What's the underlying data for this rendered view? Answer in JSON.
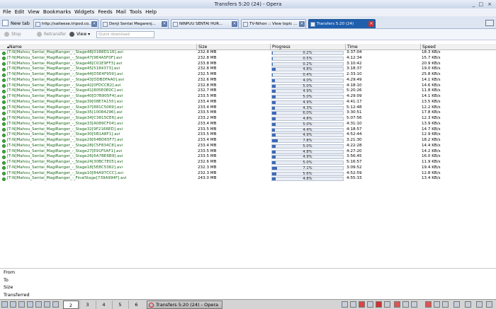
{
  "window": {
    "title": "Transfers 5:20 (24) - Opera",
    "controls": [
      "_",
      "□",
      "×"
    ]
  },
  "menu": [
    "File",
    "Edit",
    "View",
    "Bookmarks",
    "Widgets",
    "Feeds",
    "Mail",
    "Tools",
    "Help"
  ],
  "tabs": {
    "new_tab_label": "New tab",
    "items": [
      {
        "label": "http://saiteexe.tripod.co..."
      },
      {
        "label": "Denji Sentai Megarenj..."
      },
      {
        "label": "NINPUU SENTAI HUR..."
      },
      {
        "label": "TV-Nihon :: View topic ..."
      },
      {
        "label": "Transfers 5:20 (24)",
        "active": true
      }
    ]
  },
  "toolbar": {
    "stop": "Stop",
    "retransfer": "Retransfer",
    "view": "View",
    "quick_placeholder": "Quick download"
  },
  "columns": {
    "name": "Name",
    "size": "Size",
    "progress": "Progress",
    "time": "Time",
    "speed": "Speed"
  },
  "transfers": [
    {
      "name": "[T-N]Mahou_Sentai_MagiRanger_-_Stage48[01B8D116].avi",
      "size": "232.8 MB",
      "progress": 0.2,
      "progress_label": "0.2%",
      "time": "3:37:04",
      "speed": "18.3 KB/s"
    },
    {
      "name": "[T-N]Mahou_Sentai_MagiRanger_-_Stage47[9E4A5F0F].avi",
      "size": "232.8 MB",
      "progress": 0.5,
      "progress_label": "0.5%",
      "time": "4:12:34",
      "speed": "15.7 KB/s"
    },
    {
      "name": "[T-N]Mahou_Sentai_MagiRanger_-_Stage46[C01E9FF3].avi",
      "size": "233.8 MB",
      "progress": 0.2,
      "progress_label": "0.2%",
      "time": "3:10:42",
      "speed": "20.9 KB/s"
    },
    {
      "name": "[T-N]Mahou_Sentai_MagiRanger_-_Stage45[5184373].avi",
      "size": "232.8 MB",
      "progress": 4.8,
      "progress_label": "4.8%",
      "time": "3:18:37",
      "speed": "19.0 KB/s"
    },
    {
      "name": "[T-N]Mahou_Sentai_MagiRanger_-_Stage44[D5E4F959].avi",
      "size": "232.5 MB",
      "progress": 0.4,
      "progress_label": "0.4%",
      "time": "2:33:10",
      "speed": "25.8 KB/s"
    },
    {
      "name": "[T-N]Mahou_Sentai_MagiRanger_-_Stage43[DDBDFAA0].avi",
      "size": "232.6 MB",
      "progress": 4.0,
      "progress_label": "4.0%",
      "time": "4:29:49",
      "speed": "14.1 KB/s"
    },
    {
      "name": "[T-N]Mahou_Sentai_MagiRanger_-_Stage42[0FDCCB2].avi",
      "size": "232.8 MB",
      "progress": 5.0,
      "progress_label": "5.0%",
      "time": "4:18:10",
      "speed": "14.6 KB/s"
    },
    {
      "name": "[T-N]Mahou_Sentai_MagiRanger_-_Stage41[805E0E0C].avi",
      "size": "232.7 MB",
      "progress": 4.9,
      "progress_label": "4.9%",
      "time": "5:20:26",
      "speed": "11.8 KB/s"
    },
    {
      "name": "[T-N]Mahou_Sentai_MagiRanger_-_Stage40[D7B905F4].avi",
      "size": "233.5 MB",
      "progress": 5.0,
      "progress_label": "5.0%",
      "time": "4:29:09",
      "speed": "14.1 KB/s"
    },
    {
      "name": "[T-N]Mahou_Sentai_MagiRanger_-_Stage39[08E7A155].avi",
      "size": "233.4 MB",
      "progress": 4.9,
      "progress_label": "4.9%",
      "time": "4:41:17",
      "speed": "13.5 KB/s"
    },
    {
      "name": "[T-N]Mahou_Sentai_MagiRanger_-_Stage37[881C5069].avi",
      "size": "233.4 MB",
      "progress": 4.3,
      "progress_label": "4.3%",
      "time": "5:12:48",
      "speed": "12.2 KB/s"
    },
    {
      "name": "[T-N]Mahou_Sentai_MagiRanger_-_Stage35[10084296].avi",
      "size": "233.5 MB",
      "progress": 6.0,
      "progress_label": "6.0%",
      "time": "3:30:51",
      "speed": "17.8 KB/s"
    },
    {
      "name": "[T-N]Mahou_Sentai_MagiRanger_-_Stage34[C3815CE6].avi",
      "size": "233.2 MB",
      "progress": 4.8,
      "progress_label": "4.8%",
      "time": "5:07:56",
      "speed": "12.3 KB/s"
    },
    {
      "name": "[T-N]Mahou_Sentai_MagiRanger_-_Stage33[A089CF04].avi",
      "size": "233.4 MB",
      "progress": 5.0,
      "progress_label": "5.0%",
      "time": "4:31:10",
      "speed": "13.9 KB/s"
    },
    {
      "name": "[T-N]Mahou_Sentai_MagiRanger_-_Stage32[9F2166ED].avi",
      "size": "233.5 MB",
      "progress": 4.4,
      "progress_label": "4.4%",
      "time": "4:18:57",
      "speed": "14.7 KB/s"
    },
    {
      "name": "[T-N]Mahou_Sentai_MagiRanger_-_Stage30[5B1A8F1].avi",
      "size": "233.5 MB",
      "progress": 4.9,
      "progress_label": "4.9%",
      "time": "4:52:44",
      "speed": "12.9 KB/s"
    },
    {
      "name": "[T-N]Mahou_Sentai_MagiRanger_-_Stage29[64BD65F7].avi",
      "size": "233.4 MB",
      "progress": 7.8,
      "progress_label": "7.8%",
      "time": "3:21:30",
      "speed": "18.2 KB/s"
    },
    {
      "name": "[T-N]Mahou_Sentai_MagiRanger_-_Stage28[C5F834C8].avi",
      "size": "233.4 MB",
      "progress": 5.0,
      "progress_label": "5.0%",
      "time": "4:22:28",
      "speed": "14.4 KB/s"
    },
    {
      "name": "[T-N]Mahou_Sentai_MagiRanger_-_Stage27[E91F5AF1].avi",
      "size": "233.5 MB",
      "progress": 4.8,
      "progress_label": "4.8%",
      "time": "4:27:20",
      "speed": "14.2 KB/s"
    },
    {
      "name": "[T-N]Mahou_Sentai_MagiRanger_-_Stage26[6A7BE6B9].avi",
      "size": "233.5 MB",
      "progress": 4.9,
      "progress_label": "4.9%",
      "time": "3:56:45",
      "speed": "16.0 KB/s"
    },
    {
      "name": "[T-N]Mahou_Sentai_MagiRanger_-_Stage24[30BC7E05].avi",
      "size": "232.6 MB",
      "progress": 5.0,
      "progress_label": "5.0%",
      "time": "5:16:57",
      "speed": "11.9 KB/s"
    },
    {
      "name": "[T-N]Mahou_Sentai_MagiRanger_-_Stage18[5E8C5382].avi",
      "size": "232.3 MB",
      "progress": 7.1,
      "progress_label": "7.1%",
      "time": "3:09:52",
      "speed": "19.4 KB/s"
    },
    {
      "name": "[T-N]Mahou_Sentai_MagiRanger_-_Stage10[84A97CCC].avi",
      "size": "232.3 MB",
      "progress": 5.6,
      "progress_label": "5.6%",
      "time": "4:52:59",
      "speed": "12.8 KB/s"
    },
    {
      "name": "[T-N]Mahou_Sentai_MagiRanger_-_FinalStage[739A994F].avi",
      "size": "243.0 MB",
      "progress": 4.8,
      "progress_label": "4.8%",
      "time": "4:55:33",
      "speed": "13.4 KB/s"
    }
  ],
  "details": {
    "from": "From",
    "to": "To",
    "size": "Size",
    "transferred": "Transferred"
  },
  "taskbar": {
    "desktops": [
      "2",
      "3",
      "4",
      "5",
      "6"
    ],
    "active_desktop": "2",
    "task_label": "Transfers 5:20 (24) - Opera"
  },
  "colors": {
    "progress_fill": "#3c69b8",
    "active_tab": "#1f5fae",
    "status_ok": "#3bb53b"
  }
}
